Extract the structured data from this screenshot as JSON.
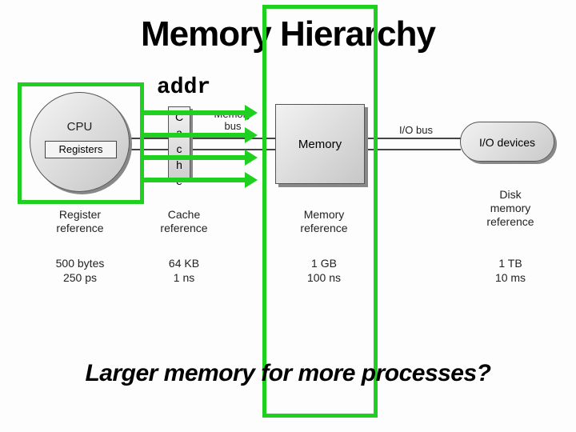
{
  "title": "Memory Hierarchy",
  "addr_label": "addr",
  "subtitle": "Larger memory for more processes?",
  "blocks": {
    "cpu": {
      "label": "CPU",
      "registers": "Registers"
    },
    "cache": {
      "l1": "C",
      "l2": "a",
      "l3": "c",
      "l4": "h",
      "l5": "e"
    },
    "memory": {
      "label": "Memory"
    },
    "io": {
      "label": "I/O devices"
    }
  },
  "buses": {
    "memory_bus": "Memory\nbus",
    "io_bus": "I/O bus"
  },
  "refs": {
    "register": "Register\nreference",
    "cache": "Cache\nreference",
    "memory": "Memory\nreference",
    "disk": "Disk\nmemory\nreference"
  },
  "specs": {
    "register": {
      "size": "500 bytes",
      "latency": "250 ps"
    },
    "cache": {
      "size": "64 KB",
      "latency": "1 ns"
    },
    "memory": {
      "size": "1 GB",
      "latency": "100 ns"
    },
    "disk": {
      "size": "1 TB",
      "latency": "10 ms"
    }
  }
}
